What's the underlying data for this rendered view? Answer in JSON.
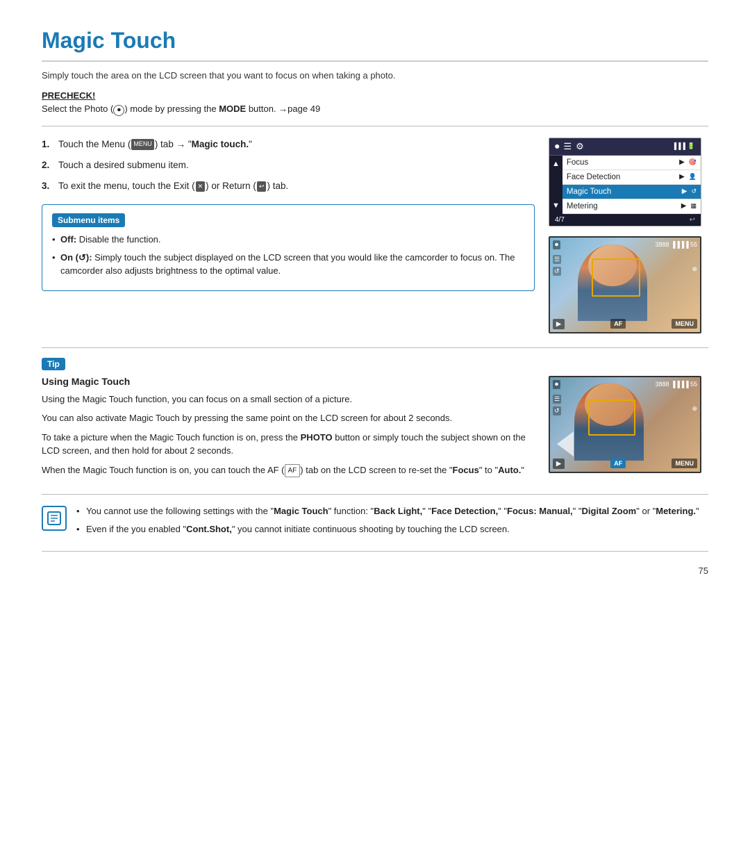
{
  "page": {
    "title": "Magic Touch",
    "intro": "Simply touch the area on the LCD screen that you want to focus on when taking a photo.",
    "precheck": {
      "label": "PRECHECK!",
      "text": "Select the Photo (⏺) mode by pressing the MODE button. →page 49"
    },
    "steps": [
      {
        "num": "1.",
        "text_before": "Touch the Menu (",
        "menu_icon": "MENU",
        "text_after": ") tab → \"Magic touch.\""
      },
      {
        "num": "2.",
        "text": "Touch a desired submenu item."
      },
      {
        "num": "3.",
        "text_before": "To exit the menu, touch the Exit (",
        "exit_icon": "✕",
        "text_mid": ") or Return (",
        "return_icon": "↩",
        "text_after": ") tab."
      }
    ],
    "submenu": {
      "header": "Submenu items",
      "items": [
        {
          "label_bold": "Off:",
          "text": " Disable the function."
        },
        {
          "label_bold": "On (↺):",
          "text": " Simply touch the subject displayed on the LCD screen that you would like the camcorder to focus on. The camcorder also adjusts brightness to the optimal value."
        }
      ]
    },
    "menu_screenshot": {
      "rows": [
        {
          "label": "Focus",
          "highlighted": false
        },
        {
          "label": "Face Detection",
          "highlighted": false
        },
        {
          "label": "Magic Touch",
          "highlighted": true
        },
        {
          "label": "Metering",
          "highlighted": false
        }
      ],
      "counter": "4/7"
    },
    "tip": {
      "label": "Tip",
      "title": "Using Magic Touch",
      "paragraphs": [
        "Using the Magic Touch function, you can focus on a small section of a picture.",
        "You can also activate Magic Touch by pressing the same point on the LCD screen for about 2 seconds.",
        "To take a picture when the Magic Touch function is on, press the PHOTO button or simply touch the subject shown on the LCD screen, and then hold for about 2 seconds.",
        "When the Magic Touch function is on, you can touch the AF (AF) tab on the LCD screen to re-set the \"Focus\" to \"Auto.\""
      ]
    },
    "notes": {
      "items": [
        "You cannot use the following settings with the \"Magic Touch\" function: \"Back Light,\" \"Face Detection,\" \"Focus: Manual,\" \"Digital Zoom\" or \"Metering.\"",
        "Even if the you enabled \"Cont.Shot,\" you cannot initiate continuous shooting by touching the LCD screen."
      ]
    },
    "page_number": "75"
  }
}
